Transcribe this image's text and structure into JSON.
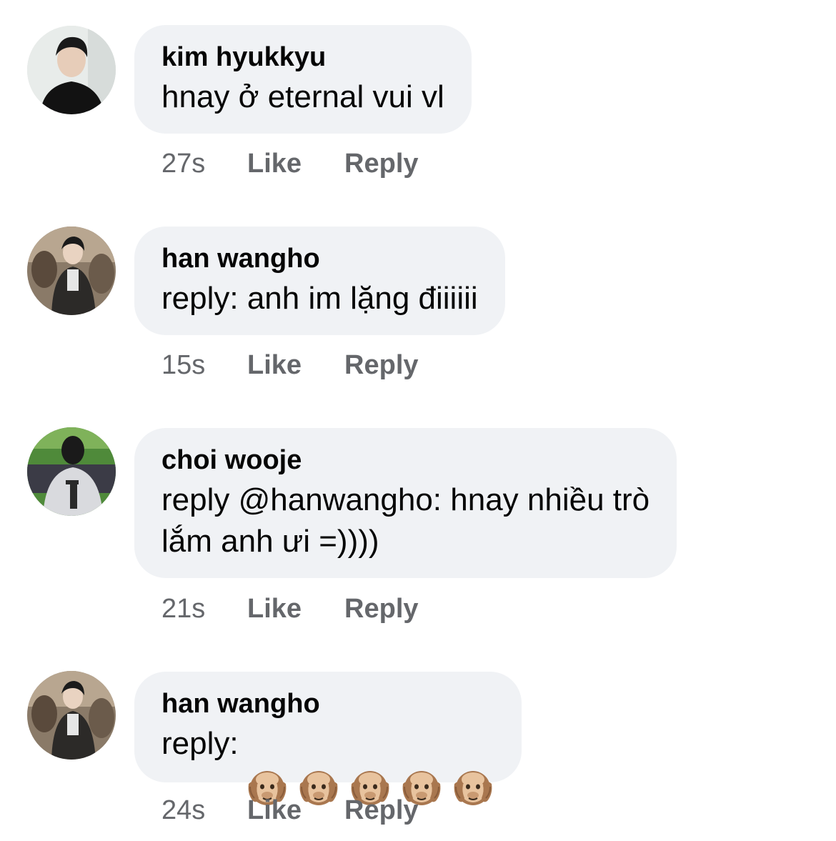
{
  "comments": [
    {
      "author": "kim hyukkyu",
      "text": "hnay ở eternal vui vl",
      "time": "27s",
      "like_label": "Like",
      "reply_label": "Reply"
    },
    {
      "author": "han wangho",
      "text": "reply: anh im lặng điiiiii",
      "time": "15s",
      "like_label": "Like",
      "reply_label": "Reply"
    },
    {
      "author": "choi wooje",
      "text": "reply @hanwangho: hnay nhiều trò\nlắm anh ưi =))))",
      "time": "21s",
      "like_label": "Like",
      "reply_label": "Reply"
    },
    {
      "author": "han wangho",
      "text": "reply:",
      "emoji_icons": [
        "hear-no-evil-monkey-icon",
        "hear-no-evil-monkey-icon",
        "hear-no-evil-monkey-icon",
        "hear-no-evil-monkey-icon",
        "hear-no-evil-monkey-icon"
      ],
      "time": "24s",
      "like_label": "Like",
      "reply_label": "Reply"
    }
  ],
  "colors": {
    "bubble": "#f0f2f5",
    "meta_text": "#65676b",
    "body_text": "#050505"
  }
}
